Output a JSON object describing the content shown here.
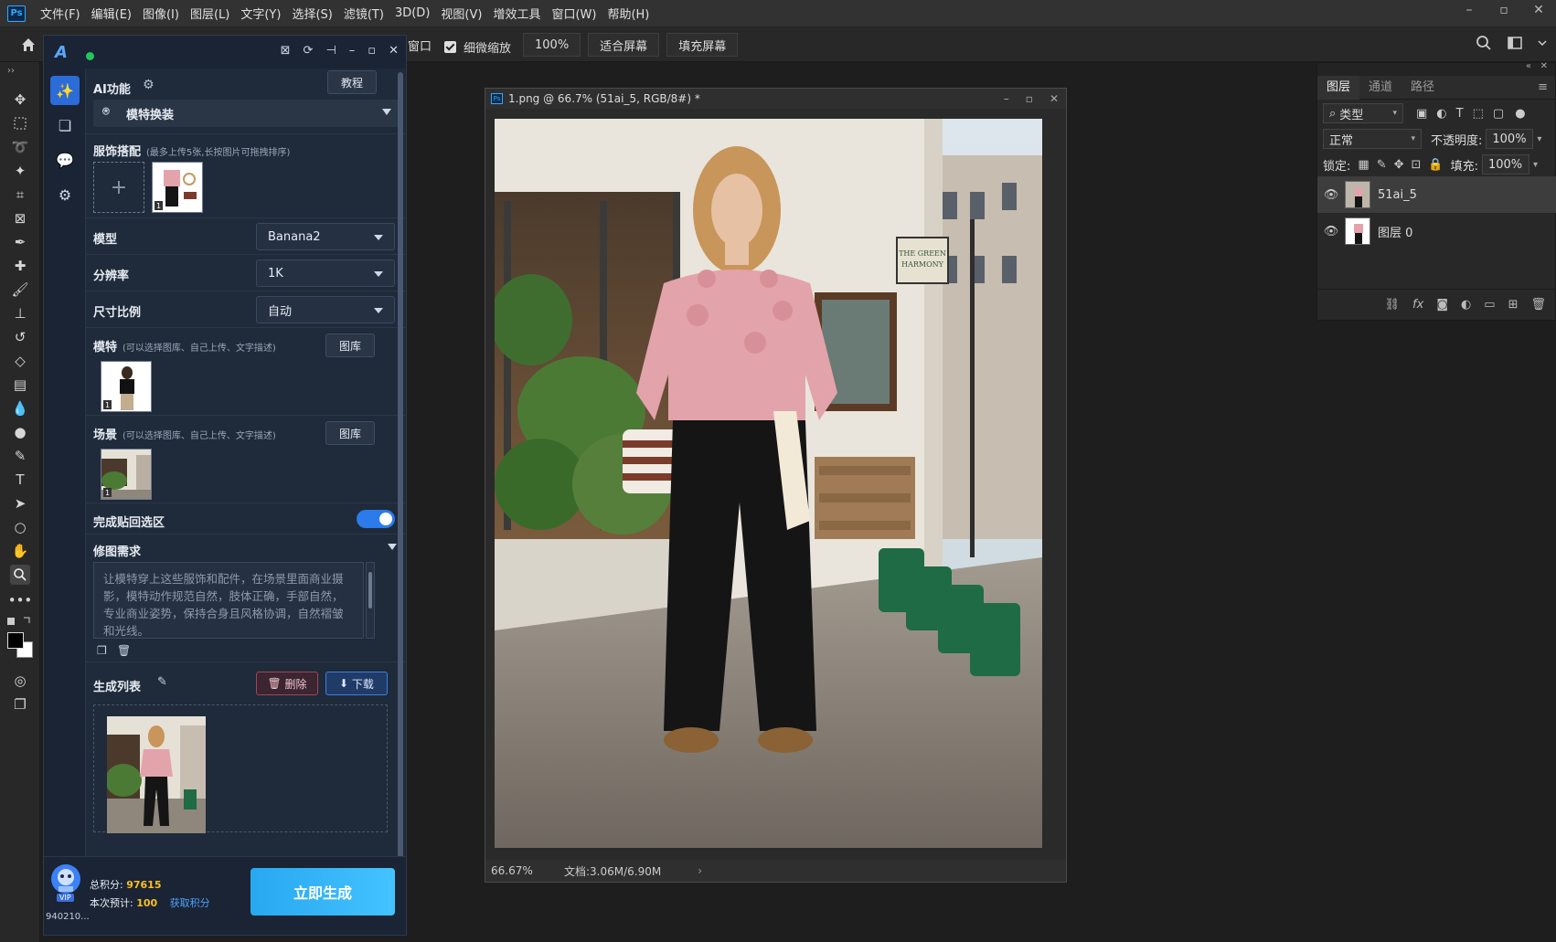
{
  "menubar": {
    "logo": "Ps",
    "items": [
      "文件(F)",
      "编辑(E)",
      "图像(I)",
      "图层(L)",
      "文字(Y)",
      "选择(S)",
      "滤镜(T)",
      "3D(D)",
      "视图(V)",
      "增效工具",
      "窗口(W)",
      "帮助(H)"
    ],
    "window_controls": [
      "–",
      "▫",
      "✕"
    ]
  },
  "options": {
    "partial_label": "窗口",
    "scrubby_zoom": "细微缩放",
    "zoom_value": "100%",
    "fit_screen": "适合屏幕",
    "fill_screen": "填充屏幕"
  },
  "plugin": {
    "header_icons": [
      "⊠",
      "⟳",
      "⊣",
      "–",
      "▫",
      "✕"
    ],
    "ai_func_label": "AI功能",
    "tutorial_btn": "教程",
    "func_selected": "模特换装",
    "clothing": {
      "label": "服饰搭配",
      "hint": "(最多上传5张,长按图片可拖拽排序)",
      "add": "+",
      "thumb_num": "1"
    },
    "model_field": {
      "label": "模型",
      "value": "Banana2"
    },
    "resolution": {
      "label": "分辨率",
      "value": "1K"
    },
    "ratio": {
      "label": "尺寸比例",
      "value": "自动"
    },
    "model_person": {
      "label": "模特",
      "hint": "(可以选择图库、自己上传、文字描述)",
      "gallery_btn": "图库",
      "thumb_num": "1"
    },
    "scene": {
      "label": "场景",
      "hint": "(可以选择图库、自己上传、文字描述)",
      "gallery_btn": "图库",
      "thumb_num": "1"
    },
    "paste_back": {
      "label": "完成贴回选区",
      "on": true
    },
    "retouch": {
      "label": "修图需求",
      "placeholder": "让模特穿上这些服饰和配件，在场景里面商业摄影，模特动作规范自然，肢体正确，手部自然，专业商业姿势，保持合身且风格协调，自然褶皱和光线。"
    },
    "gen_list": {
      "label": "生成列表",
      "delete_btn": "删除",
      "download_btn": "下载"
    },
    "footer": {
      "vip": "VIP",
      "user_id": "940210...",
      "total_label": "总积分:",
      "total_value": "97615",
      "cost_label": "本次预计:",
      "cost_value": "100",
      "get_points": "获取积分",
      "generate_btn": "立即生成"
    }
  },
  "document": {
    "title": "1.png @ 66.7% (51ai_5, RGB/8#) *",
    "zoom": "66.67%",
    "doc_info": "文档:3.06M/6.90M",
    "sign_text": "THE GREEN HARMONY"
  },
  "layers": {
    "tabs": [
      "图层",
      "通道",
      "路径"
    ],
    "filter_kind": "类型",
    "blend_mode": "正常",
    "opacity_label": "不透明度:",
    "opacity_value": "100%",
    "lock_label": "锁定:",
    "fill_label": "填充:",
    "fill_value": "100%",
    "items": [
      {
        "name": "51ai_5",
        "selected": true
      },
      {
        "name": "图层 0",
        "selected": false
      }
    ]
  }
}
